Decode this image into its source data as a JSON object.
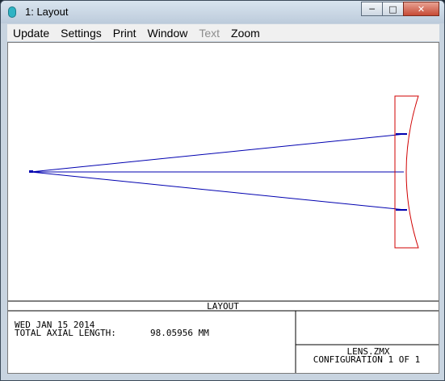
{
  "window": {
    "title": "1: Layout",
    "caption_buttons": [
      "minimize",
      "maximize",
      "close"
    ]
  },
  "menu": {
    "items": [
      {
        "label": "Update",
        "enabled": true
      },
      {
        "label": "Settings",
        "enabled": true
      },
      {
        "label": "Print",
        "enabled": true
      },
      {
        "label": "Window",
        "enabled": true
      },
      {
        "label": "Text",
        "enabled": false
      },
      {
        "label": "Zoom",
        "enabled": true
      }
    ]
  },
  "plot": {
    "colors": {
      "rays": "#0000b0",
      "lens": "#d00000",
      "frame": "#000000"
    }
  },
  "info": {
    "section_title": "LAYOUT",
    "date": "WED JAN 15 2014",
    "axial_length_label": "TOTAL AXIAL LENGTH:",
    "axial_length_value": "98.05956 MM",
    "file_name": "LENS.ZMX",
    "configuration": "CONFIGURATION 1 OF 1"
  }
}
